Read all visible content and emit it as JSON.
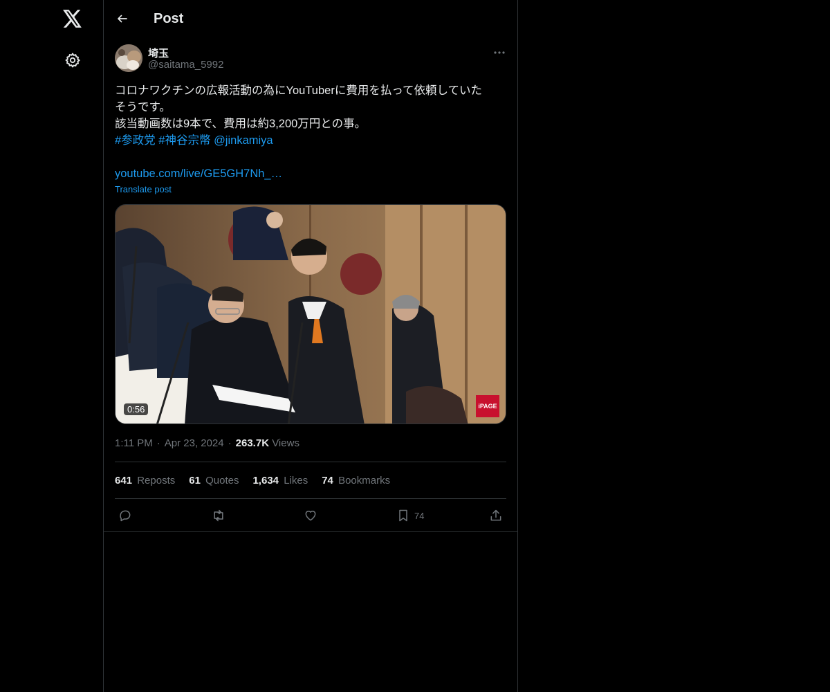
{
  "nav": {
    "logo_icon": "x-logo-icon",
    "settings_icon": "gear-icon"
  },
  "header": {
    "title": "Post"
  },
  "post": {
    "author": {
      "name": "埼玉",
      "handle": "@saitama_5992"
    },
    "text": {
      "line1": "コロナワクチンの広報活動の為にYouTuberに費用を払って依頼していた",
      "line2": "そうです。",
      "line3": "該当動画数は9本で、費用は約3,200万円との事。",
      "tag1": "#参政党",
      "tag2": "#神谷宗幣",
      "mention": "@jinkamiya",
      "url": "youtube.com/live/GE5GH7Nh_…"
    },
    "translate": "Translate post",
    "video": {
      "duration": "0:56",
      "brand": "iPAGE"
    },
    "meta": {
      "time": "1:11 PM",
      "date": "Apr 23, 2024",
      "views": "263.7K",
      "views_label": "Views",
      "sep": "·"
    },
    "stats": {
      "reposts": "641",
      "reposts_label": "Reposts",
      "quotes": "61",
      "quotes_label": "Quotes",
      "likes": "1,634",
      "likes_label": "Likes",
      "bookmarks": "74",
      "bookmarks_label": "Bookmarks"
    },
    "actions": {
      "bookmark_count": "74"
    }
  },
  "colors": {
    "background": "#000000",
    "text": "#e7e9ea",
    "muted": "#71767b",
    "accent": "#1d9bf0",
    "border": "#2f3336"
  }
}
